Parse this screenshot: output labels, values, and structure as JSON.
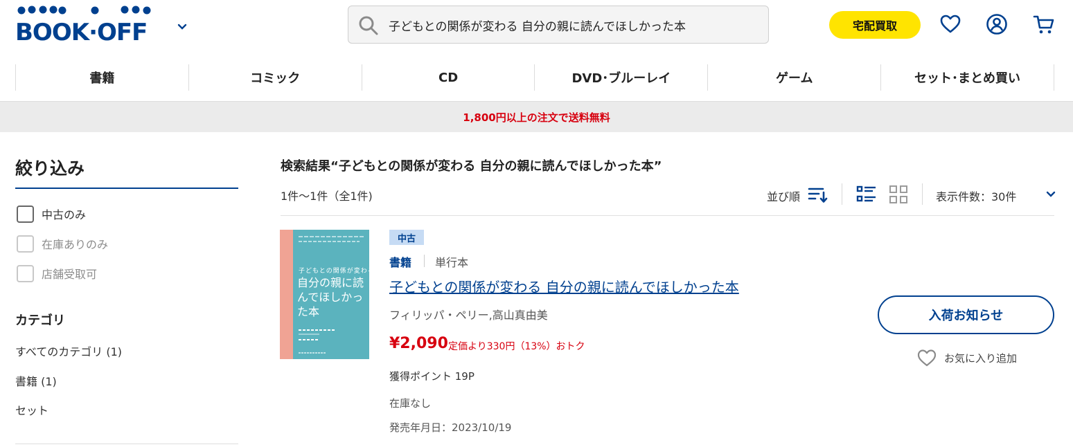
{
  "header": {
    "logo_text": "BOOK·OFF",
    "search": {
      "value": "子どもとの関係が変わる 自分の親に読んでほしかった本",
      "placeholder": ""
    },
    "kaitori_label": "宅配買取",
    "icons": [
      "chevron-down-icon",
      "search-icon",
      "heart-icon",
      "account-icon",
      "cart-icon"
    ]
  },
  "nav": {
    "items": [
      {
        "label": "書籍"
      },
      {
        "label": "コミック"
      },
      {
        "label": "CD"
      },
      {
        "label": "DVD･ブルーレイ"
      },
      {
        "label": "ゲーム"
      },
      {
        "label": "セット･まとめ買い"
      }
    ]
  },
  "banner": {
    "text": "1,800円以上の注文で送料無料"
  },
  "sidebar": {
    "title": "絞り込み",
    "filters": [
      {
        "label": "中古のみ",
        "checked": false,
        "enabled": true
      },
      {
        "label": "在庫ありのみ",
        "checked": false,
        "enabled": false
      },
      {
        "label": "店舗受取可",
        "checked": false,
        "enabled": false
      }
    ],
    "category_title": "カテゴリ",
    "categories": [
      {
        "label": "すべてのカテゴリ (1)"
      },
      {
        "label": "書籍 (1)"
      },
      {
        "label": "セット"
      }
    ]
  },
  "results": {
    "title": "検索結果“子どもとの関係が変わる 自分の親に読んでほしかった本”",
    "count": "1件～1件（全1件)",
    "sort_label": "並び順",
    "per_page_label": "表示件数：30件"
  },
  "product": {
    "badge": "中古",
    "genre": "書籍",
    "format": "単行本",
    "title": "子どもとの関係が変わる 自分の親に読んでほしかった本",
    "author": "フィリッパ・ペリー,高山真由美",
    "price": "¥2,090",
    "discount": "定価より330円（13%）おトク",
    "points": "獲得ポイント 19P",
    "stock": "在庫なし",
    "release": "発売年月日：2023/10/19",
    "cover": {
      "subtitle": "子どもとの関係が変わる",
      "title": "自分の親に読んでほしかった本"
    },
    "notify_label": "入荷お知らせ",
    "favorite_label": "お気に入り追加"
  },
  "colors": {
    "brand_blue": "#00408f",
    "accent_yellow": "#ffe400",
    "sale_red": "#d7000f",
    "banner_bg": "#ebebeb"
  }
}
